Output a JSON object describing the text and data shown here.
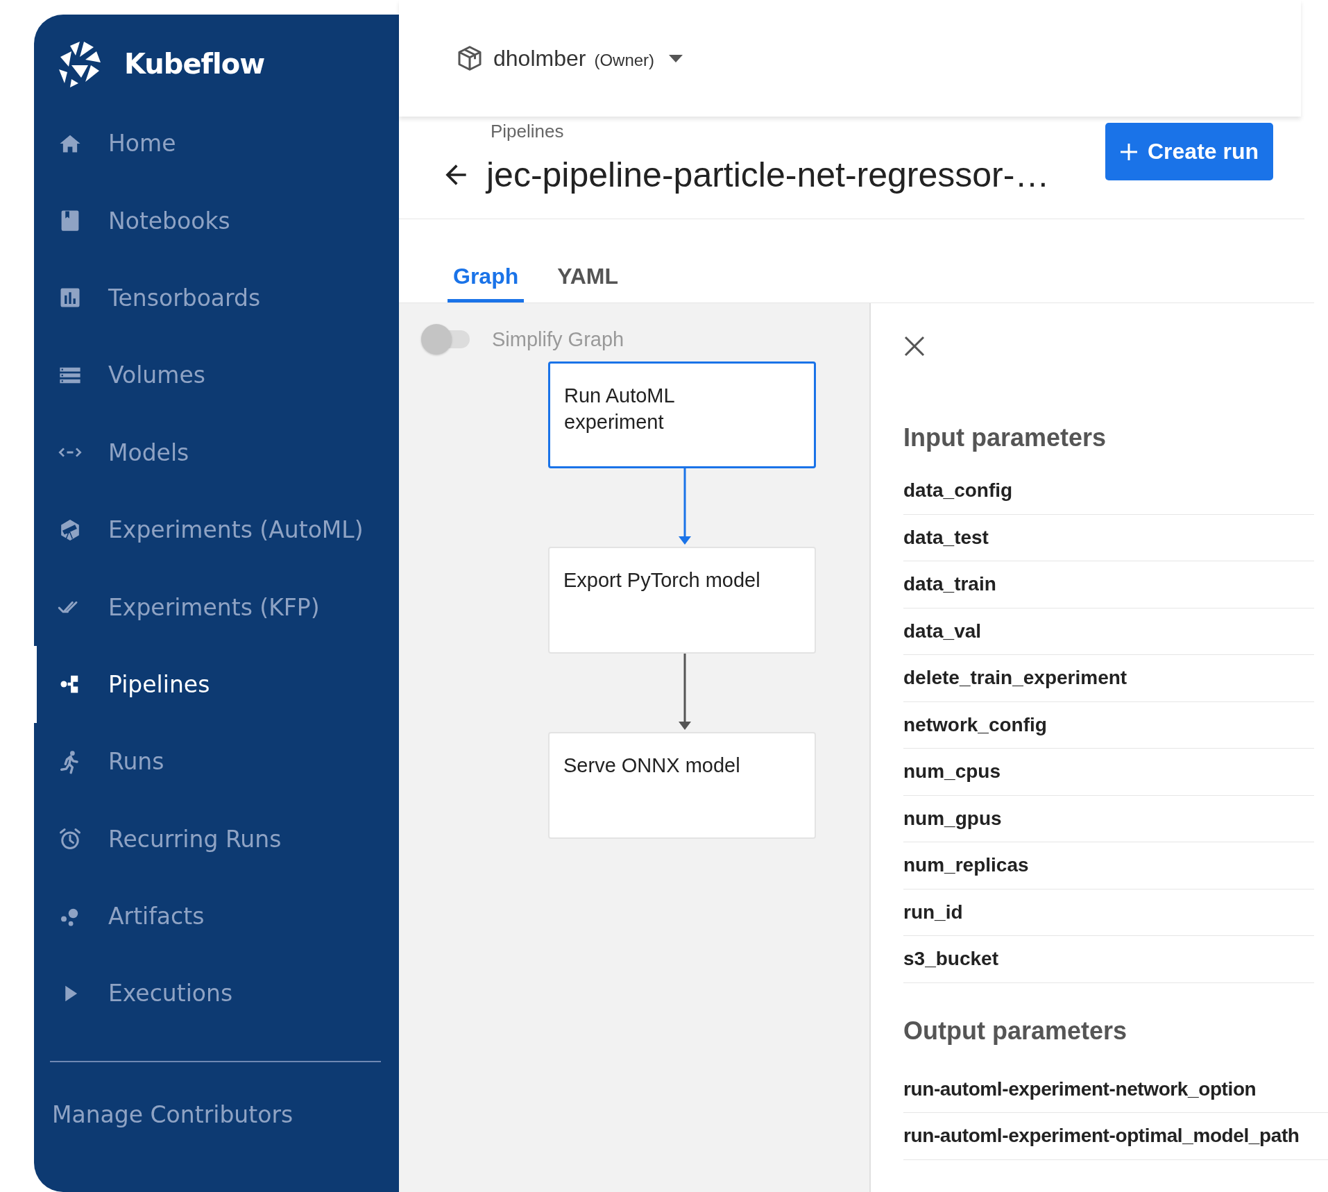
{
  "sidebar": {
    "logo": "Kubeflow",
    "items": [
      {
        "label": "Home",
        "selected": false
      },
      {
        "label": "Notebooks",
        "selected": false
      },
      {
        "label": "Tensorboards",
        "selected": false
      },
      {
        "label": "Volumes",
        "selected": false
      },
      {
        "label": "Models",
        "selected": false
      },
      {
        "label": "Experiments (AutoML)",
        "selected": false
      },
      {
        "label": "Experiments (KFP)",
        "selected": false
      },
      {
        "label": "Pipelines",
        "selected": true
      },
      {
        "label": "Runs",
        "selected": false
      },
      {
        "label": "Recurring Runs",
        "selected": false
      },
      {
        "label": "Artifacts",
        "selected": false
      },
      {
        "label": "Executions",
        "selected": false
      }
    ],
    "footer_link": "Manage Contributors"
  },
  "header": {
    "namespace": "dholmber",
    "role": "(Owner)"
  },
  "page": {
    "breadcrumb": "Pipelines",
    "title": "jec-pipeline-particle-net-regressor-…",
    "create_button": "Create run"
  },
  "tabs": [
    {
      "label": "Graph",
      "selected": true
    },
    {
      "label": "YAML",
      "selected": false
    }
  ],
  "graph": {
    "simplify_toggle": {
      "label": "Simplify Graph",
      "on": false
    },
    "nodes": [
      {
        "label": "Run AutoML experiment",
        "selected": true
      },
      {
        "label": "Export PyTorch model",
        "selected": false
      },
      {
        "label": "Serve ONNX model",
        "selected": false
      }
    ]
  },
  "side_panel": {
    "input_heading": "Input parameters",
    "inputs": [
      "data_config",
      "data_test",
      "data_train",
      "data_val",
      "delete_train_experiment",
      "network_config",
      "num_cpus",
      "num_gpus",
      "num_replicas",
      "run_id",
      "s3_bucket"
    ],
    "output_heading": "Output parameters",
    "outputs": [
      "run-automl-experiment-network_option",
      "run-automl-experiment-optimal_model_path"
    ]
  }
}
